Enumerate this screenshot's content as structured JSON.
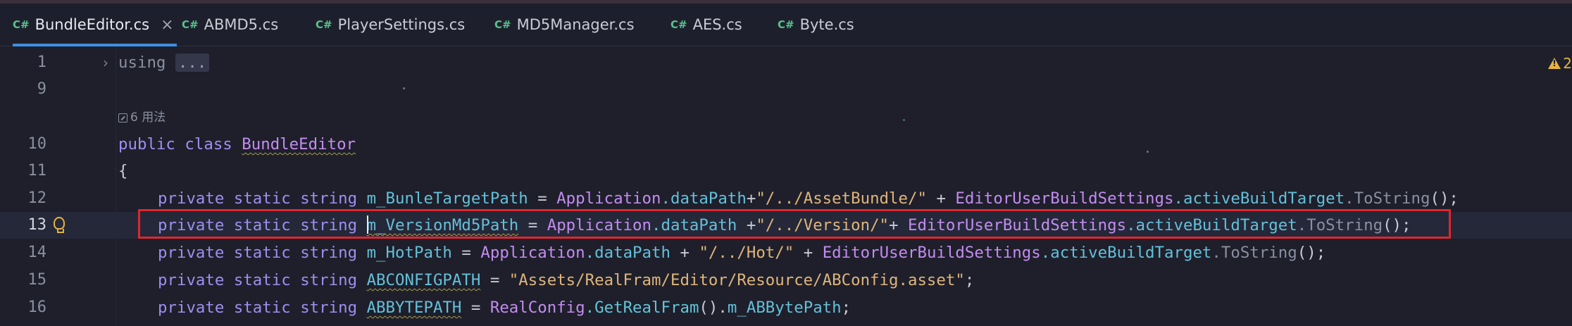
{
  "tabs": [
    {
      "icon": "C#",
      "label": "BundleEditor.cs",
      "active": true,
      "close": "×"
    },
    {
      "icon": "C#",
      "label": "ABMD5.cs"
    },
    {
      "icon": "C#",
      "label": "PlayerSettings.cs"
    },
    {
      "icon": "C#",
      "label": "MD5Manager.cs"
    },
    {
      "icon": "C#",
      "label": "AES.cs"
    },
    {
      "icon": "C#",
      "label": "Byte.cs"
    }
  ],
  "warning_count": "2",
  "usages_label": "6 用法",
  "lines": {
    "l1": {
      "num": "1",
      "using": "using",
      "ellipsis": "..."
    },
    "l9": {
      "num": "9"
    },
    "l10": {
      "num": "10",
      "kw1": "public",
      "kw2": "class",
      "name": "BundleEditor"
    },
    "l11": {
      "num": "11",
      "text": "{"
    },
    "l12": {
      "num": "12",
      "mods": "private static string",
      "field": "m_BunleTargetPath",
      "eq": " = ",
      "t1": "Application",
      "f1": ".dataPath",
      "op1": "+",
      "s1": "\"/../AssetBundle/\"",
      "op2": " + ",
      "t2": "EditorUserBuildSettings",
      "f2": ".activeBuildTarget",
      "m1": ".ToString",
      "end": "();"
    },
    "l13": {
      "num": "13",
      "mods": "private static string",
      "field": "m_VersionMd5Path",
      "eq": " = ",
      "t1": "Application",
      "f1": ".dataPath",
      "op1": " +",
      "s1": "\"/../Version/\"",
      "op2": "+ ",
      "t2": "EditorUserBuildSettings",
      "f2": ".activeBuildTarget",
      "m1": ".ToString",
      "end": "();"
    },
    "l14": {
      "num": "14",
      "mods": "private static string",
      "field": "m_HotPath",
      "eq": " = ",
      "t1": "Application",
      "f1": ".dataPath",
      "op1": " + ",
      "s1": "\"/../Hot/\"",
      "op2": " + ",
      "t2": "EditorUserBuildSettings",
      "f2": ".activeBuildTarget",
      "m1": ".ToString",
      "end": "();"
    },
    "l15": {
      "num": "15",
      "mods": "private static string",
      "field": "ABCONFIGPATH",
      "eq": " = ",
      "s1": "\"Assets/RealFram/Editor/Resource/ABConfig.asset\"",
      "end": ";"
    },
    "l16": {
      "num": "16",
      "mods": "private static string",
      "field": "ABBYTEPATH",
      "eq": " = ",
      "t1": "RealConfig",
      "m1": ".GetRealFram",
      "p1": "().",
      "f1": "m_ABBytePath",
      "end": ";"
    }
  }
}
